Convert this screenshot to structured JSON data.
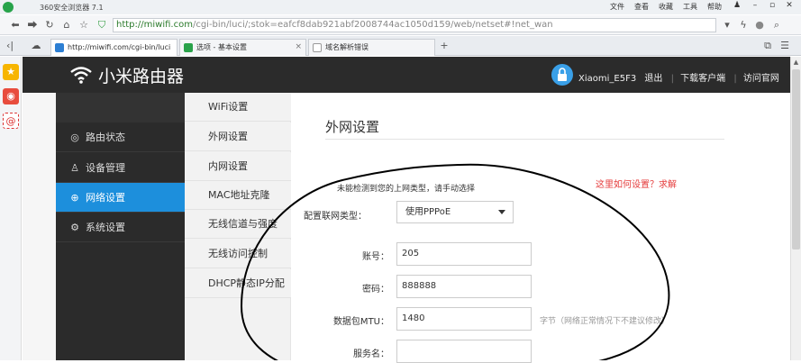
{
  "browser": {
    "title": "360安全浏览器 7.1",
    "menu": [
      "文件",
      "查看",
      "收藏",
      "工具",
      "帮助"
    ],
    "address_host": "http://miwifi.com",
    "address_path": "/cgi-bin/luci/;stok=eafcf8dab921abf2008744ac1050d159/web/netset#!net_wan",
    "tabs": [
      {
        "label": "http://miwifi.com/cgi-bin/luci",
        "icon": "blue"
      },
      {
        "label": "选项 - 基本设置",
        "icon": "green"
      },
      {
        "label": "域名解析错误",
        "icon": "page"
      }
    ]
  },
  "router": {
    "brand": "小米路由器",
    "header": {
      "device": "Xiaomi_E5F3",
      "logout": "退出",
      "download": "下载客户端",
      "official": "访问官网"
    },
    "nav": [
      {
        "label": "路由状态",
        "icon": "status-icon"
      },
      {
        "label": "设备管理",
        "icon": "user-icon"
      },
      {
        "label": "网络设置",
        "icon": "globe-icon"
      },
      {
        "label": "系统设置",
        "icon": "gear-icon"
      }
    ],
    "subnav": [
      "WiFi设置",
      "外网设置",
      "内网设置",
      "MAC地址克隆",
      "无线信道与强度",
      "无线访问控制",
      "DHCP静态IP分配"
    ]
  },
  "form": {
    "title": "外网设置",
    "notice": "未能检测到您的上网类型，请手动选择",
    "help": "这里如何设置？求解",
    "type_label": "配置联网类型：",
    "type_value": "使用PPPoE",
    "account_label": "账号：",
    "account_value": "205",
    "password_label": "密码：",
    "password_value": "888888",
    "mtu_label": "数据包MTU：",
    "mtu_value": "1480",
    "mtu_unit": "字节（网络正常情况下不建议修改）",
    "service_label": "服务名：",
    "service_value": ""
  },
  "colors": {
    "accent": "#1d8fdc",
    "header_bg": "#2b2b2b",
    "help_link": "#e53c3c",
    "annotation": "#000000"
  }
}
